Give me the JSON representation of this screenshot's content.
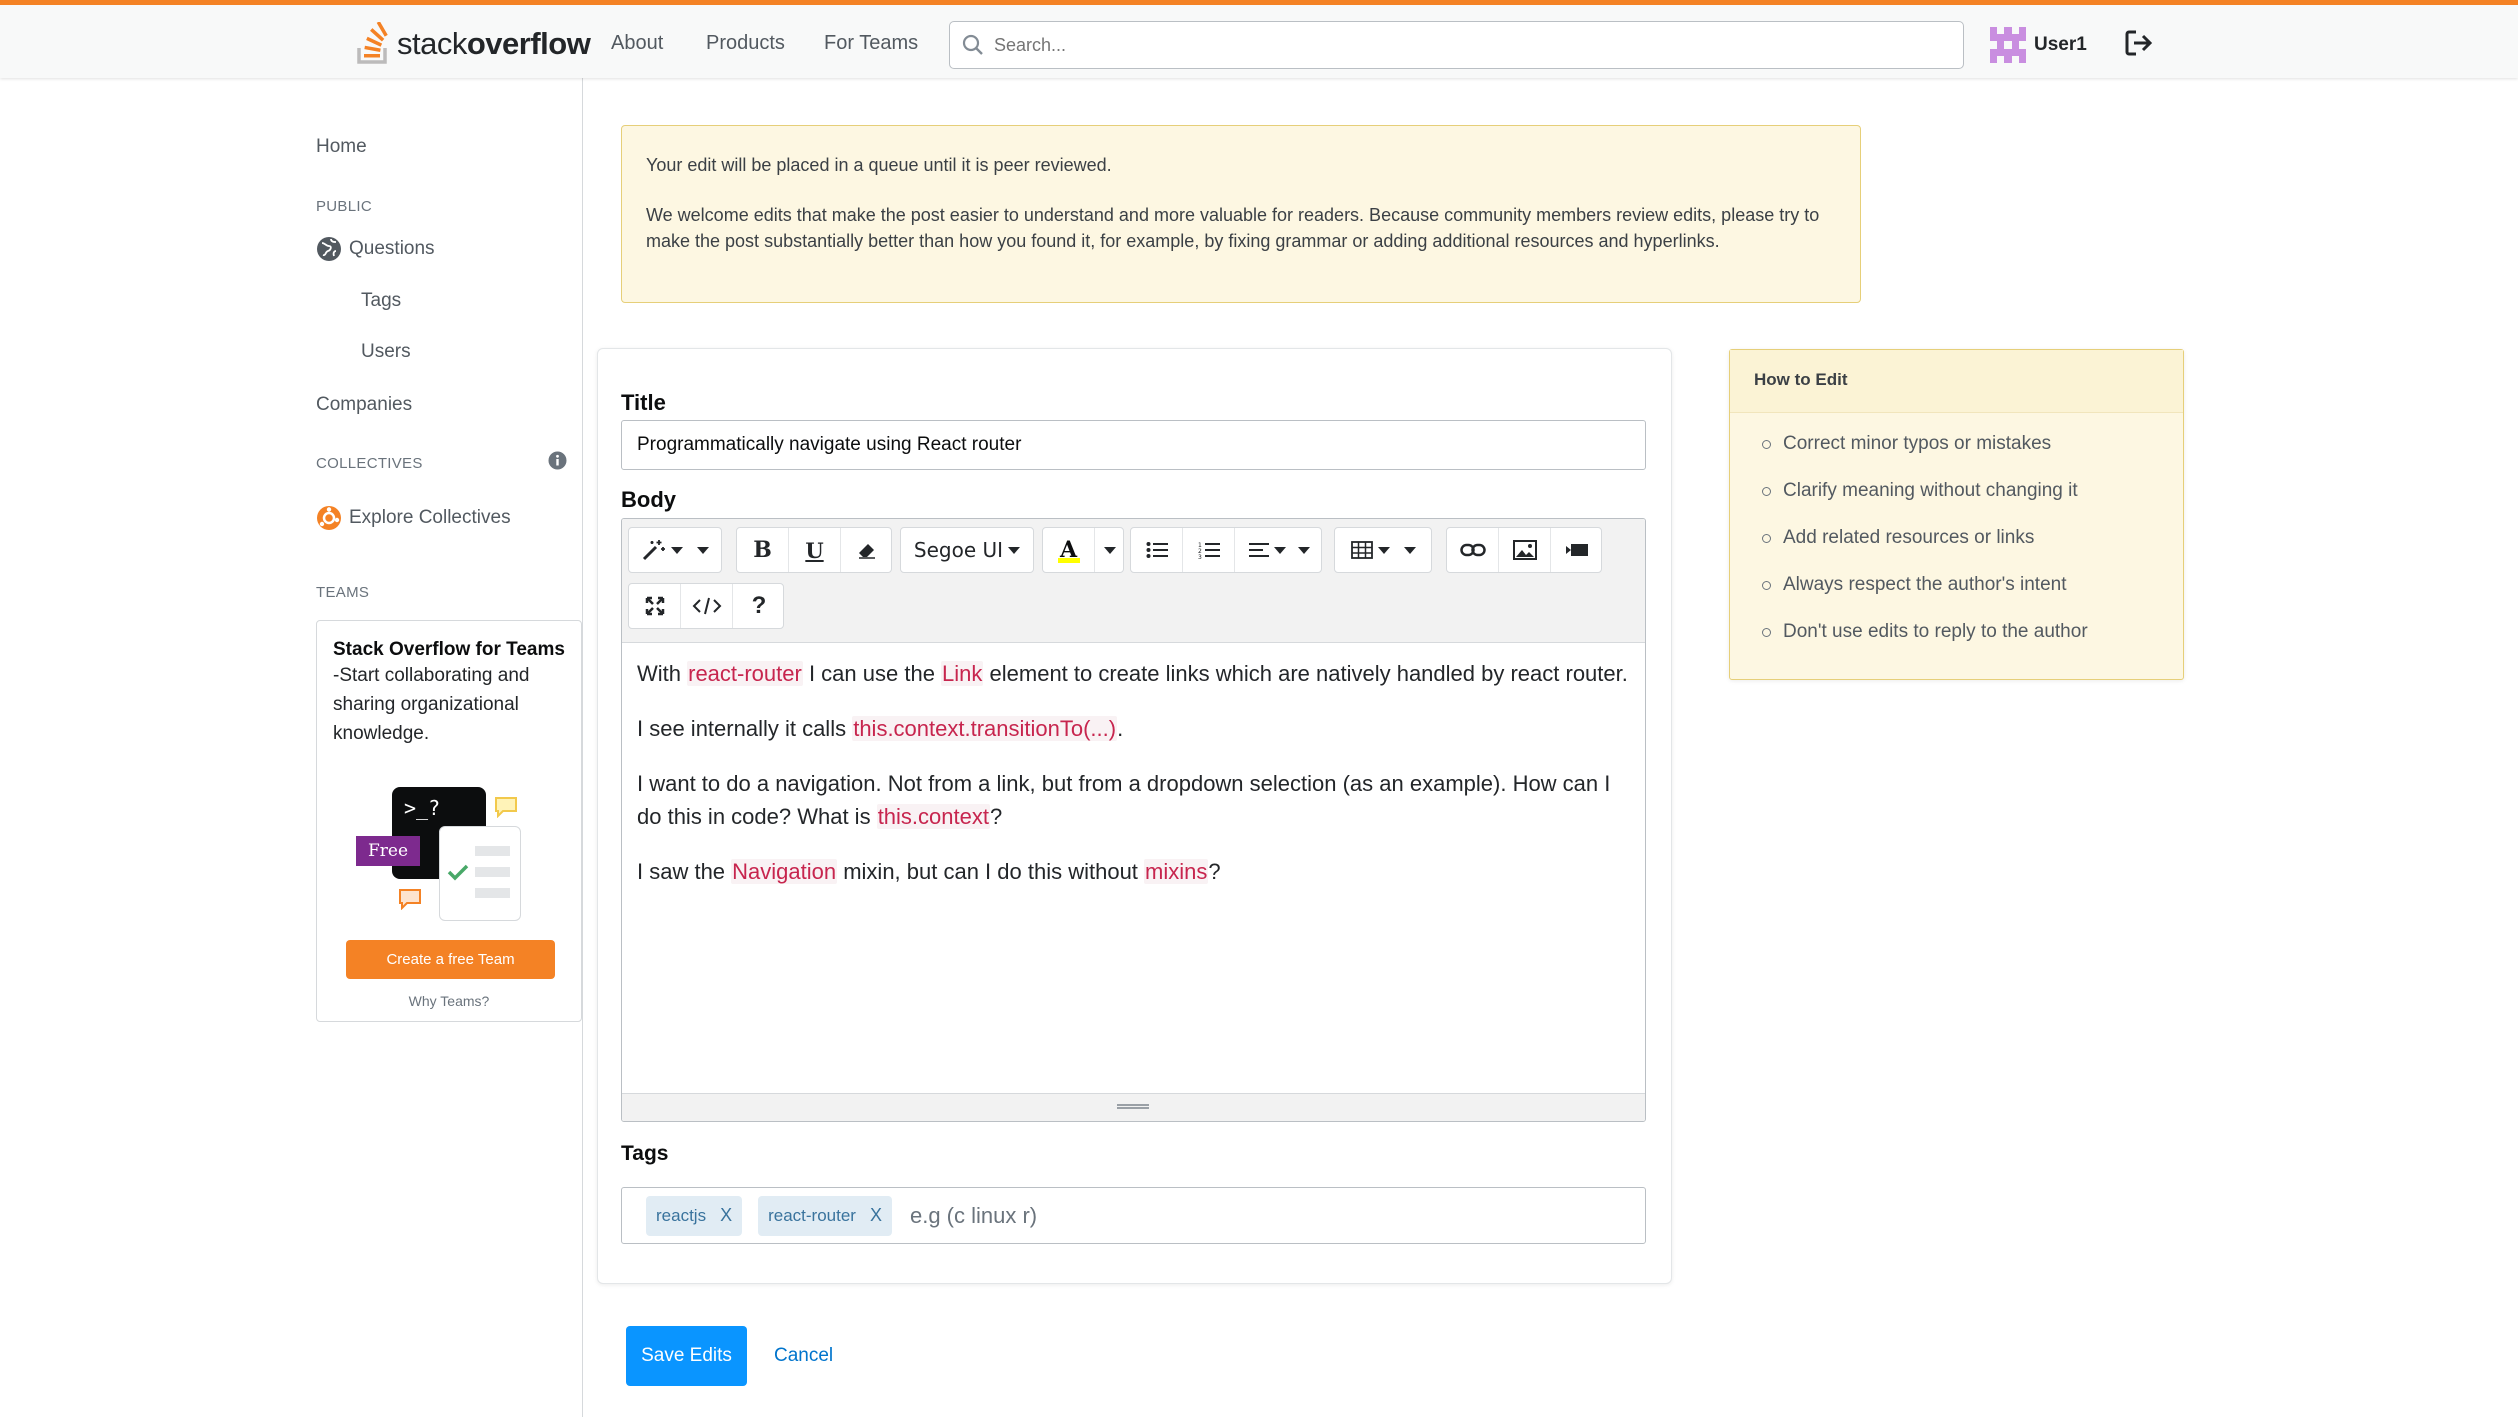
{
  "brand": {
    "logo_word1": "stack",
    "logo_word2": "overflow",
    "accent": "#f48225",
    "primary": "#0a95ff"
  },
  "nav": {
    "about": "About",
    "products": "Products",
    "for_teams": "For Teams"
  },
  "search": {
    "placeholder": "Search..."
  },
  "user": {
    "name": "User1"
  },
  "sidebar": {
    "home": "Home",
    "public_heading": "PUBLIC",
    "questions": "Questions",
    "tags": "Tags",
    "users": "Users",
    "companies": "Companies",
    "collectives_heading": "COLLECTIVES",
    "explore_collectives": "Explore Collectives",
    "teams_heading": "TEAMS",
    "teams_card": {
      "title": "Stack Overflow for Teams",
      "description": "-Start collaborating and sharing organizational knowledge.",
      "free_badge": "Free",
      "terminal_text": ">_?",
      "cta": "Create a free Team",
      "why": "Why Teams?"
    }
  },
  "notice": {
    "line1": "Your edit will be placed in a queue until it is peer reviewed.",
    "line2": "We welcome edits that make the post easier to understand and more valuable for readers. Because community members review edits, please try to make the post substantially better than how you found it, for example, by fixing grammar or adding additional resources and hyperlinks."
  },
  "form": {
    "title_label": "Title",
    "title_value": "Programmatically navigate using React router",
    "body_label": "Body",
    "font_name": "Segoe UI",
    "body": {
      "p1": [
        "With ",
        "react-router",
        " I can use the ",
        "Link",
        " element to create links which are natively handled by react router."
      ],
      "p2": [
        "I see internally it calls ",
        "this.context.transitionTo(...)",
        "."
      ],
      "p3": [
        "I want to do a navigation. Not from a link, but from a dropdown selection (as an example). How can I do this in code? What is ",
        "this.context",
        "?"
      ],
      "p4": [
        "I saw the ",
        "Navigation",
        " mixin, but can I do this without ",
        "mixins",
        "?"
      ]
    },
    "tags_label": "Tags",
    "tags": [
      "reactjs",
      "react-router"
    ],
    "tag_remove": "X",
    "tags_placeholder": "e.g (c linux r)",
    "save": "Save Edits",
    "cancel": "Cancel"
  },
  "how_to_edit": {
    "title": "How to Edit",
    "items": [
      "Correct minor typos or mistakes",
      "Clarify meaning without changing it",
      "Add related resources or links",
      "Always respect the author's intent",
      "Don't use edits to reply to the author"
    ]
  }
}
